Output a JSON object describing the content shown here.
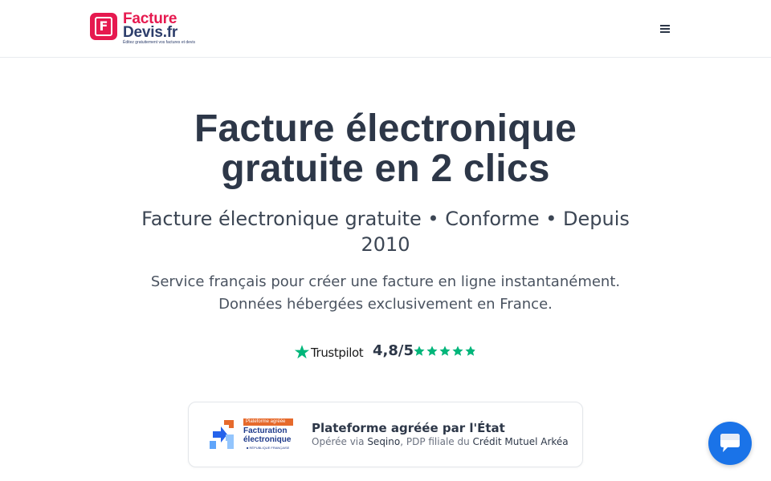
{
  "header": {
    "logo": {
      "line1": "Facture",
      "line2": "Devis.fr",
      "tagline": "Éditez gratuitement vos factures et devis",
      "mark_letter": "F"
    },
    "menu_icon": "hamburger-icon"
  },
  "hero": {
    "title_line1": "Facture électronique",
    "title_line2": "gratuite en 2 clics",
    "subtitle": "Facture électronique gratuite • Conforme • Depuis 2010",
    "description_line1": "Service français pour créer une facture en ligne instantanément.",
    "description_line2": "Données hébergées exclusivement en France."
  },
  "trust": {
    "brand": "Trustpilot",
    "rating": "4,8/5",
    "stars": 4.8,
    "star_color": "#00b67a"
  },
  "badge": {
    "logo_label": "Plateforme agréée",
    "logo_name_line1": "Facturation",
    "logo_name_line2": "électronique",
    "logo_country": "■ RÉPUBLIQUE FRANÇAISE",
    "title": "Plateforme agréée par l'État",
    "sub_prefix": "Opérée via ",
    "sub_partner": "Seqino",
    "sub_middle": ", PDP filiale du ",
    "sub_bank": "Crédit Mutuel Arkéa"
  },
  "chat": {
    "icon": "chat-bubble-icon"
  },
  "colors": {
    "brand": "#e6194f",
    "navy": "#2d3e6b",
    "text": "#2d3748",
    "chat": "#1a73e8"
  }
}
